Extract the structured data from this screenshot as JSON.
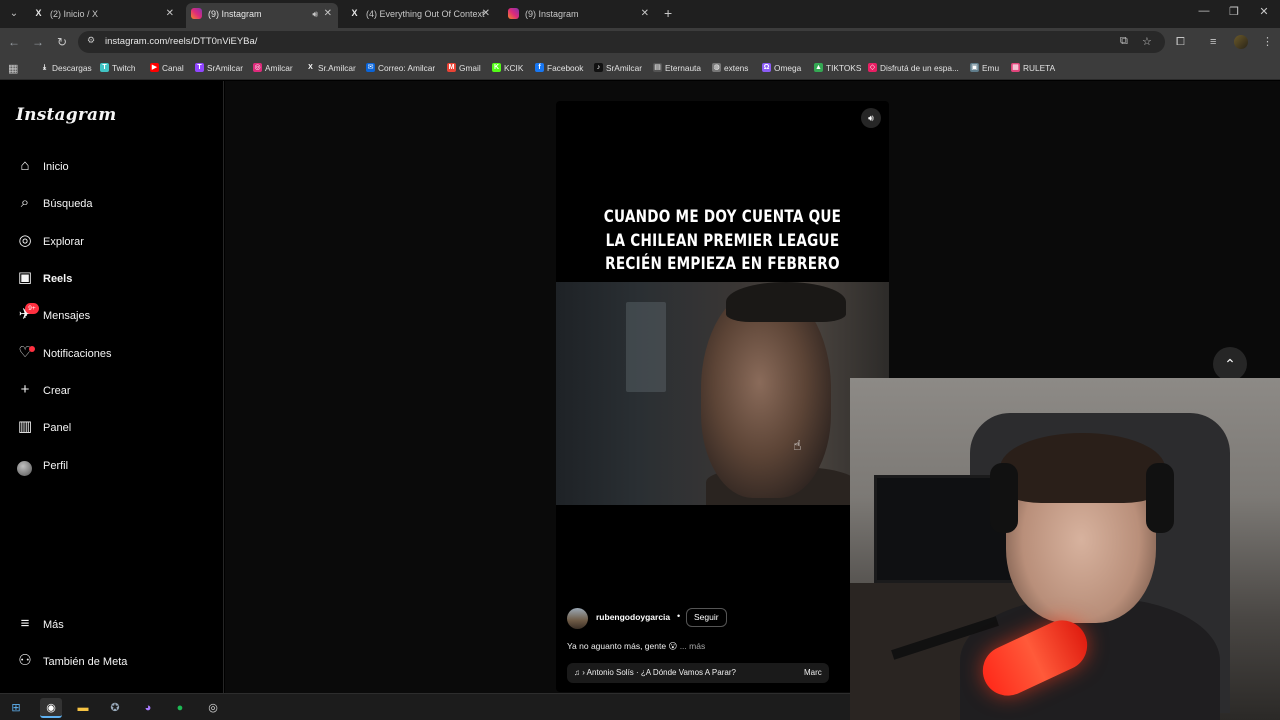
{
  "browser": {
    "tabs": [
      {
        "title": "(2) Inicio / X",
        "icon": "x"
      },
      {
        "title": "(9) Instagram",
        "icon": "ig",
        "active": true,
        "audio": true
      },
      {
        "title": "(4) Everything Out Of Context",
        "icon": "x"
      },
      {
        "title": "(9) Instagram",
        "icon": "ig"
      }
    ],
    "url": "instagram.com/reels/DTT0nViEYBa/",
    "bookmarks": [
      {
        "label": "Descargas",
        "color": "#3c3c3c",
        "glyph": "⤓"
      },
      {
        "label": "Twitch",
        "color": "#41c4c4",
        "glyph": "T"
      },
      {
        "label": "Canal",
        "color": "#ff0000",
        "glyph": "▶"
      },
      {
        "label": "SrAmilcar",
        "color": "#9146ff",
        "glyph": "T"
      },
      {
        "label": "Amilcar",
        "color": "#dd2a7b",
        "glyph": "◎"
      },
      {
        "label": "Sr.Amilcar",
        "color": "#3c3c3c",
        "glyph": "X"
      },
      {
        "label": "Correo: Amilcar",
        "color": "#0a64d8",
        "glyph": "✉"
      },
      {
        "label": "Gmail",
        "color": "#ea4335",
        "glyph": "M"
      },
      {
        "label": "KCIK",
        "color": "#53fc18",
        "glyph": "K"
      },
      {
        "label": "Facebook",
        "color": "#1877f2",
        "glyph": "f"
      },
      {
        "label": "SrAmilcar",
        "color": "#111111",
        "glyph": "♪"
      },
      {
        "label": "Eternauta",
        "color": "#555555",
        "glyph": "▤"
      },
      {
        "label": "extens",
        "color": "#777777",
        "glyph": "◍"
      },
      {
        "label": "Omega",
        "color": "#8b5cf6",
        "glyph": "Ω"
      },
      {
        "label": "TIKTOKS",
        "color": "#34a853",
        "glyph": "▲"
      },
      {
        "label": "Disfrutá de un espa...",
        "color": "#e91e63",
        "glyph": "◇"
      },
      {
        "label": "Emu",
        "color": "#607d8b",
        "glyph": "▣"
      },
      {
        "label": "RULETA",
        "color": "#e0457b",
        "glyph": "▦"
      }
    ]
  },
  "instagram": {
    "logo": "Instagram",
    "nav": [
      {
        "label": "Inicio",
        "icon": "home-icon",
        "glyph": "⌂"
      },
      {
        "label": "Búsqueda",
        "icon": "search-icon",
        "glyph": "⌕"
      },
      {
        "label": "Explorar",
        "icon": "compass-icon",
        "glyph": "◎"
      },
      {
        "label": "Reels",
        "icon": "reels-icon",
        "glyph": "▣",
        "bold": true
      },
      {
        "label": "Mensajes",
        "icon": "messenger-icon",
        "glyph": "✈",
        "badge": "9+"
      },
      {
        "label": "Notificaciones",
        "icon": "heart-icon",
        "glyph": "♡",
        "dot": true
      },
      {
        "label": "Crear",
        "icon": "plus-icon",
        "glyph": "+"
      },
      {
        "label": "Panel",
        "icon": "chart-icon",
        "glyph": "▥"
      },
      {
        "label": "Perfil",
        "icon": "profile-icon",
        "glyph": ""
      }
    ],
    "bottom_nav": [
      {
        "label": "Más",
        "icon": "menu-icon",
        "glyph": "≡"
      },
      {
        "label": "También de Meta",
        "icon": "meta-icon",
        "glyph": "⚇"
      }
    ],
    "reel": {
      "overlay_text_lines": [
        "CUANDO ME DOY CUENTA QUE",
        "LA CHILEAN PREMIER LEAGUE",
        "RECIÉN EMPIEZA EN FEBRERO"
      ],
      "username": "rubengodoygarcia",
      "separator": "•",
      "follow_label": "Seguir",
      "caption": "Ya no aguanto más, gente 😮",
      "more_label": "... más",
      "music": "♫ › Antonio Solís · ¿A Dónde Vamos A Parar?",
      "music_tail": "Marc"
    }
  },
  "colors": {
    "accent_badge": "#ff3040",
    "chrome_bg": "#3c3c3c",
    "tabstrip_bg": "#1f1f1f"
  }
}
